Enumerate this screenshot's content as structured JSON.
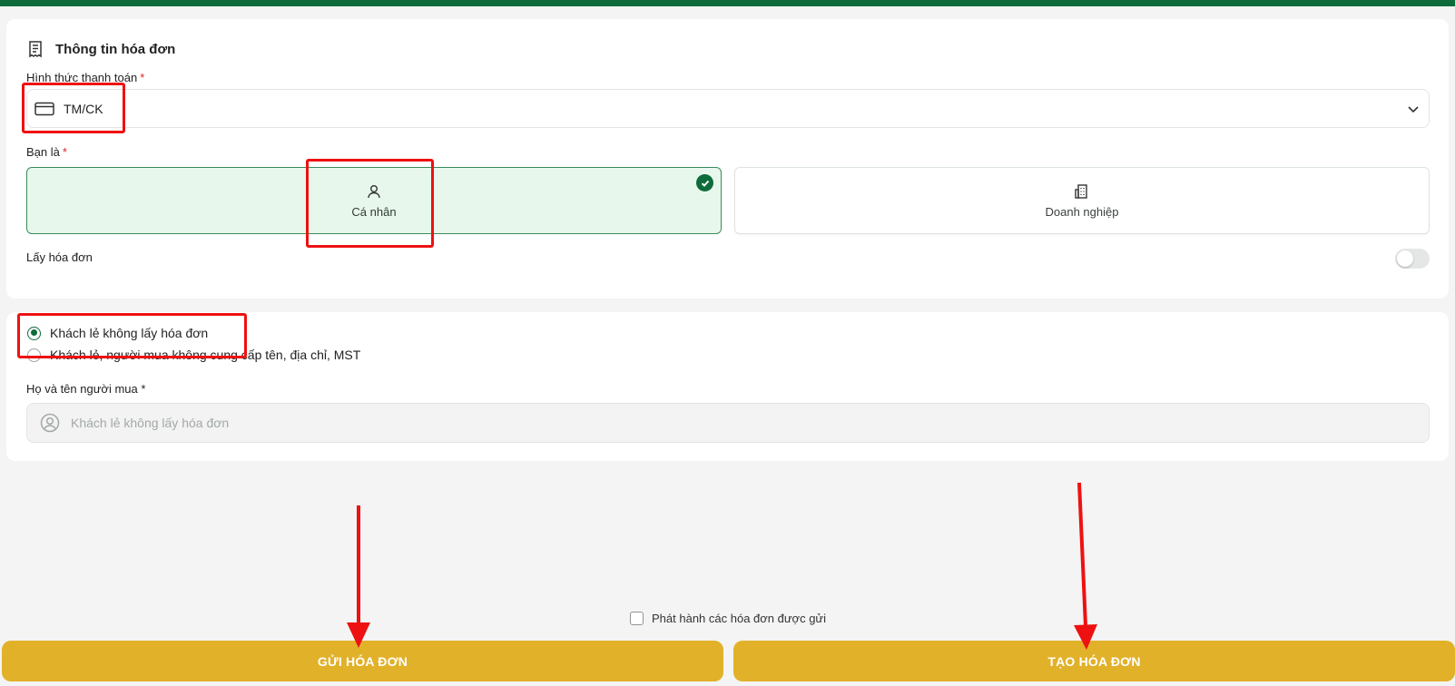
{
  "invoice_info": {
    "section_title": "Thông tin hóa đơn",
    "payment_label": "Hình thức thanh toán",
    "payment_value": "TM/CK",
    "you_are_label": "Bạn là",
    "options": [
      {
        "label": "Cá nhân",
        "selected": true
      },
      {
        "label": "Doanh nghiệp",
        "selected": false
      }
    ],
    "get_invoice_label": "Lấy hóa đơn",
    "get_invoice_enabled": false,
    "required_mark": "*"
  },
  "buyer": {
    "radios": [
      {
        "label": "Khách lẻ không lấy hóa đơn",
        "selected": true
      },
      {
        "label": "Khách lẻ, người mua không cung cấp tên, địa chỉ, MST",
        "selected": false
      }
    ],
    "name_label": "Họ và tên người mua",
    "name_placeholder": "Khách lẻ không lấy hóa đơn"
  },
  "footer": {
    "publish_label": "Phát hành các hóa đơn được gửi",
    "publish_checked": false,
    "send_button": "GỬI HÓA ĐƠN",
    "create_button": "TẠO HÓA ĐƠN"
  },
  "colors": {
    "brand_green": "#0f6b3a",
    "button_gold": "#e2b12a",
    "annotation_red": "#ee1111"
  }
}
